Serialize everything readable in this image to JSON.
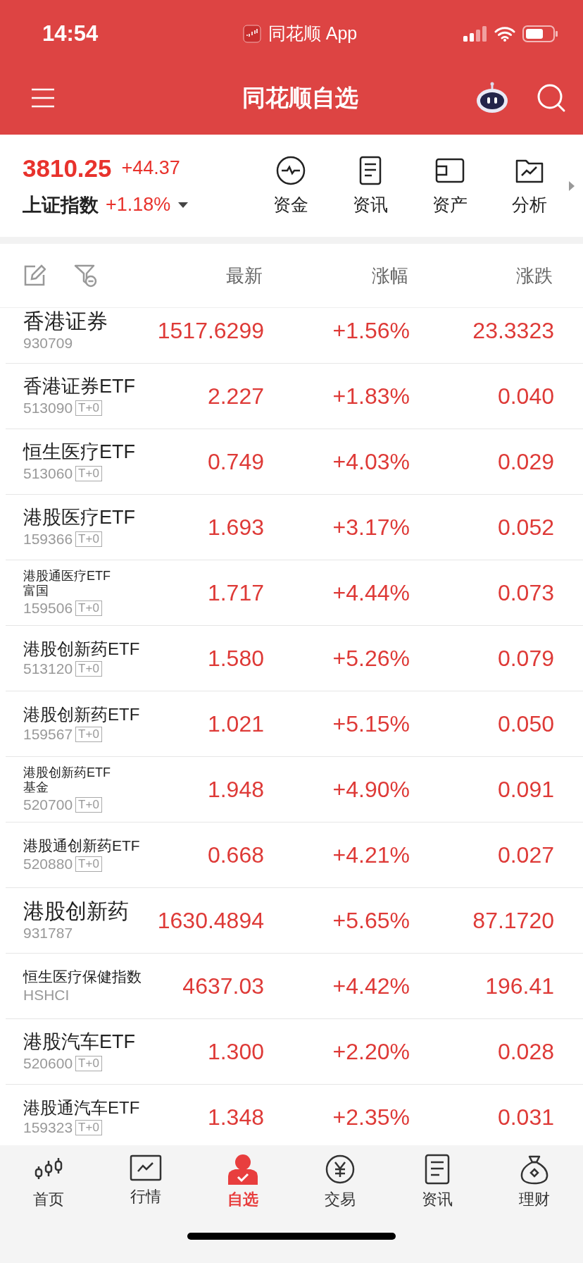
{
  "status_bar": {
    "time": "14:54",
    "app": "同花顺 App"
  },
  "header": {
    "title": "同花顺自选"
  },
  "index": {
    "value": "3810.25",
    "change": "+44.37",
    "name": "上证指数",
    "percent": "+1.18%"
  },
  "shortcuts": [
    {
      "kind": "fund",
      "label": "资金"
    },
    {
      "kind": "news",
      "label": "资讯"
    },
    {
      "kind": "asset",
      "label": "资产"
    },
    {
      "kind": "analysis",
      "label": "分析"
    }
  ],
  "table": {
    "columns": [
      "最新",
      "涨幅",
      "涨跌"
    ],
    "rows": [
      {
        "name": "香港证券",
        "code": "930709",
        "price": "1517.6299",
        "pct": "+1.56%",
        "change": "23.3323"
      },
      {
        "name": "香港证券ETF",
        "code": "513090",
        "tag": "T+0",
        "price": "2.227",
        "pct": "+1.83%",
        "change": "0.040"
      },
      {
        "name": "恒生医疗ETF",
        "code": "513060",
        "tag": "T+0",
        "price": "0.749",
        "pct": "+4.03%",
        "change": "0.029"
      },
      {
        "name": "港股医疗ETF",
        "code": "159366",
        "tag": "T+0",
        "price": "1.693",
        "pct": "+3.17%",
        "change": "0.052"
      },
      {
        "name": "港股通医疗ETF富国",
        "code": "159506",
        "tag": "T+0",
        "price": "1.717",
        "pct": "+4.44%",
        "change": "0.073"
      },
      {
        "name": "港股创新药ETF",
        "code": "513120",
        "tag": "T+0",
        "price": "1.580",
        "pct": "+5.26%",
        "change": "0.079"
      },
      {
        "name": "港股创新药ETF",
        "code": "159567",
        "tag": "T+0",
        "price": "1.021",
        "pct": "+5.15%",
        "change": "0.050"
      },
      {
        "name": "港股创新药ETF基金",
        "code": "520700",
        "tag": "T+0",
        "price": "1.948",
        "pct": "+4.90%",
        "change": "0.091"
      },
      {
        "name": "港股通创新药ETF",
        "code": "520880",
        "tag": "T+0",
        "price": "0.668",
        "pct": "+4.21%",
        "change": "0.027"
      },
      {
        "name": "港股创新药",
        "code": "931787",
        "price": "1630.4894",
        "pct": "+5.65%",
        "change": "87.1720"
      },
      {
        "name": "恒生医疗保健指数",
        "code": "HSHCI",
        "price": "4637.03",
        "pct": "+4.42%",
        "change": "196.41"
      },
      {
        "name": "港股汽车ETF",
        "code": "520600",
        "tag": "T+0",
        "price": "1.300",
        "pct": "+2.20%",
        "change": "0.028"
      },
      {
        "name": "港股通汽车ETF",
        "code": "159323",
        "tag": "T+0",
        "price": "1.348",
        "pct": "+2.35%",
        "change": "0.031"
      }
    ]
  },
  "tab_bar": [
    {
      "kind": "home",
      "label": "首页",
      "selected": false
    },
    {
      "kind": "market",
      "label": "行情",
      "selected": false
    },
    {
      "kind": "watch",
      "label": "自选",
      "selected": true
    },
    {
      "kind": "trade",
      "label": "交易",
      "selected": false
    },
    {
      "kind": "news",
      "label": "资讯",
      "selected": false
    },
    {
      "kind": "wealth",
      "label": "理财",
      "selected": false
    }
  ]
}
